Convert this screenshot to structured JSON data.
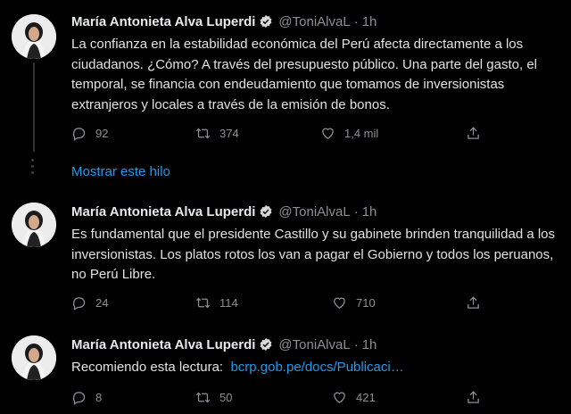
{
  "tweets": [
    {
      "name": "María Antonieta Alva Luperdi",
      "handle": "@ToniAlvaL",
      "dot": "·",
      "time": "1h",
      "text": "La confianza en la estabilidad económica del Perú afecta directamente a los ciudadanos. ¿Cómo? A través del presupuesto público. Una parte del gasto, el temporal, se financia con endeudamiento que tomamos de inversionistas extranjeros y locales a través de la emisión de bonos.",
      "replies": "92",
      "retweets": "374",
      "likes": "1,4 mil"
    },
    {
      "name": "María Antonieta Alva Luperdi",
      "handle": "@ToniAlvaL",
      "dot": "·",
      "time": "1h",
      "text": "Es fundamental que el presidente Castillo y su gabinete brinden tranquilidad a los inversionistas. Los platos rotos los van a pagar el Gobierno y todos los peruanos, no Perú Libre.",
      "replies": "24",
      "retweets": "114",
      "likes": "710"
    },
    {
      "name": "María Antonieta Alva Luperdi",
      "handle": "@ToniAlvaL",
      "dot": "·",
      "time": "1h",
      "text": "Recomiendo esta lectura:",
      "link": "bcrp.gob.pe/docs/Publicaci…",
      "replies": "8",
      "retweets": "50",
      "likes": "421"
    }
  ],
  "show_thread": "Mostrar este hilo",
  "colors": {
    "background": "#000000",
    "link": "#1d9bf0",
    "verified": "#1d9bf0",
    "muted": "#8b8f94"
  },
  "icons": [
    "reply-icon",
    "retweet-icon",
    "like-icon",
    "share-icon",
    "verified-badge-icon"
  ]
}
